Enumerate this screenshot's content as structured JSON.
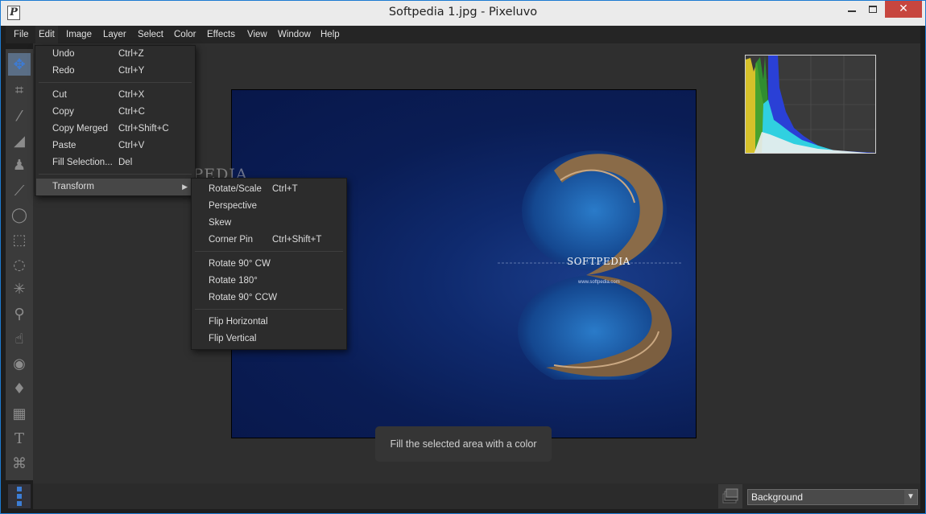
{
  "window": {
    "title": "Softpedia 1.jpg - Pixeluvo",
    "app_icon_letter": "P",
    "close_glyph": "✕"
  },
  "menubar": {
    "items": [
      "File",
      "Edit",
      "Image",
      "Layer",
      "Select",
      "Color",
      "Effects",
      "View",
      "Window",
      "Help"
    ]
  },
  "edit_menu": {
    "items": [
      {
        "label": "Undo",
        "shortcut": "Ctrl+Z"
      },
      {
        "label": "Redo",
        "shortcut": "Ctrl+Y"
      },
      {
        "label": "Cut",
        "shortcut": "Ctrl+X"
      },
      {
        "label": "Copy",
        "shortcut": "Ctrl+C"
      },
      {
        "label": "Copy Merged",
        "shortcut": "Ctrl+Shift+C"
      },
      {
        "label": "Paste",
        "shortcut": "Ctrl+V"
      },
      {
        "label": "Fill Selection...",
        "shortcut": "Del"
      },
      {
        "label": "Transform",
        "shortcut": ""
      }
    ]
  },
  "transform_menu": {
    "items": [
      {
        "label": "Rotate/Scale",
        "shortcut": "Ctrl+T"
      },
      {
        "label": "Perspective",
        "shortcut": ""
      },
      {
        "label": "Skew",
        "shortcut": ""
      },
      {
        "label": "Corner Pin",
        "shortcut": "Ctrl+Shift+T"
      },
      {
        "label": "Rotate 90° CW",
        "shortcut": ""
      },
      {
        "label": "Rotate 180°",
        "shortcut": ""
      },
      {
        "label": "Rotate 90° CCW",
        "shortcut": ""
      },
      {
        "label": "Flip Horizontal",
        "shortcut": ""
      },
      {
        "label": "Flip Vertical",
        "shortcut": ""
      }
    ]
  },
  "tooltip": {
    "text": "Fill the selected area with a color"
  },
  "layers": {
    "current": "Background"
  },
  "canvas": {
    "image_brand": "SOFTPEDIA",
    "image_url": "www.softpedia.com"
  },
  "watermark": {
    "text": "SOFTPEDIA",
    "url": "www.softpedia.com"
  },
  "tools": [
    "move-icon",
    "crop-icon",
    "brush-icon",
    "eraser-icon",
    "clone-stamp-icon",
    "healing-brush-icon",
    "lasso-icon",
    "rect-select-icon",
    "ellipse-select-icon",
    "magic-wand-icon",
    "dodge-icon",
    "smudge-icon",
    "red-eye-icon",
    "paint-bucket-icon",
    "gradient-icon",
    "text-icon",
    "shape-icon"
  ],
  "colors": {
    "accent": "#3c7dd6",
    "close": "#c7463f",
    "menu_bg": "#2c2c2c",
    "highlight": "#474747"
  }
}
